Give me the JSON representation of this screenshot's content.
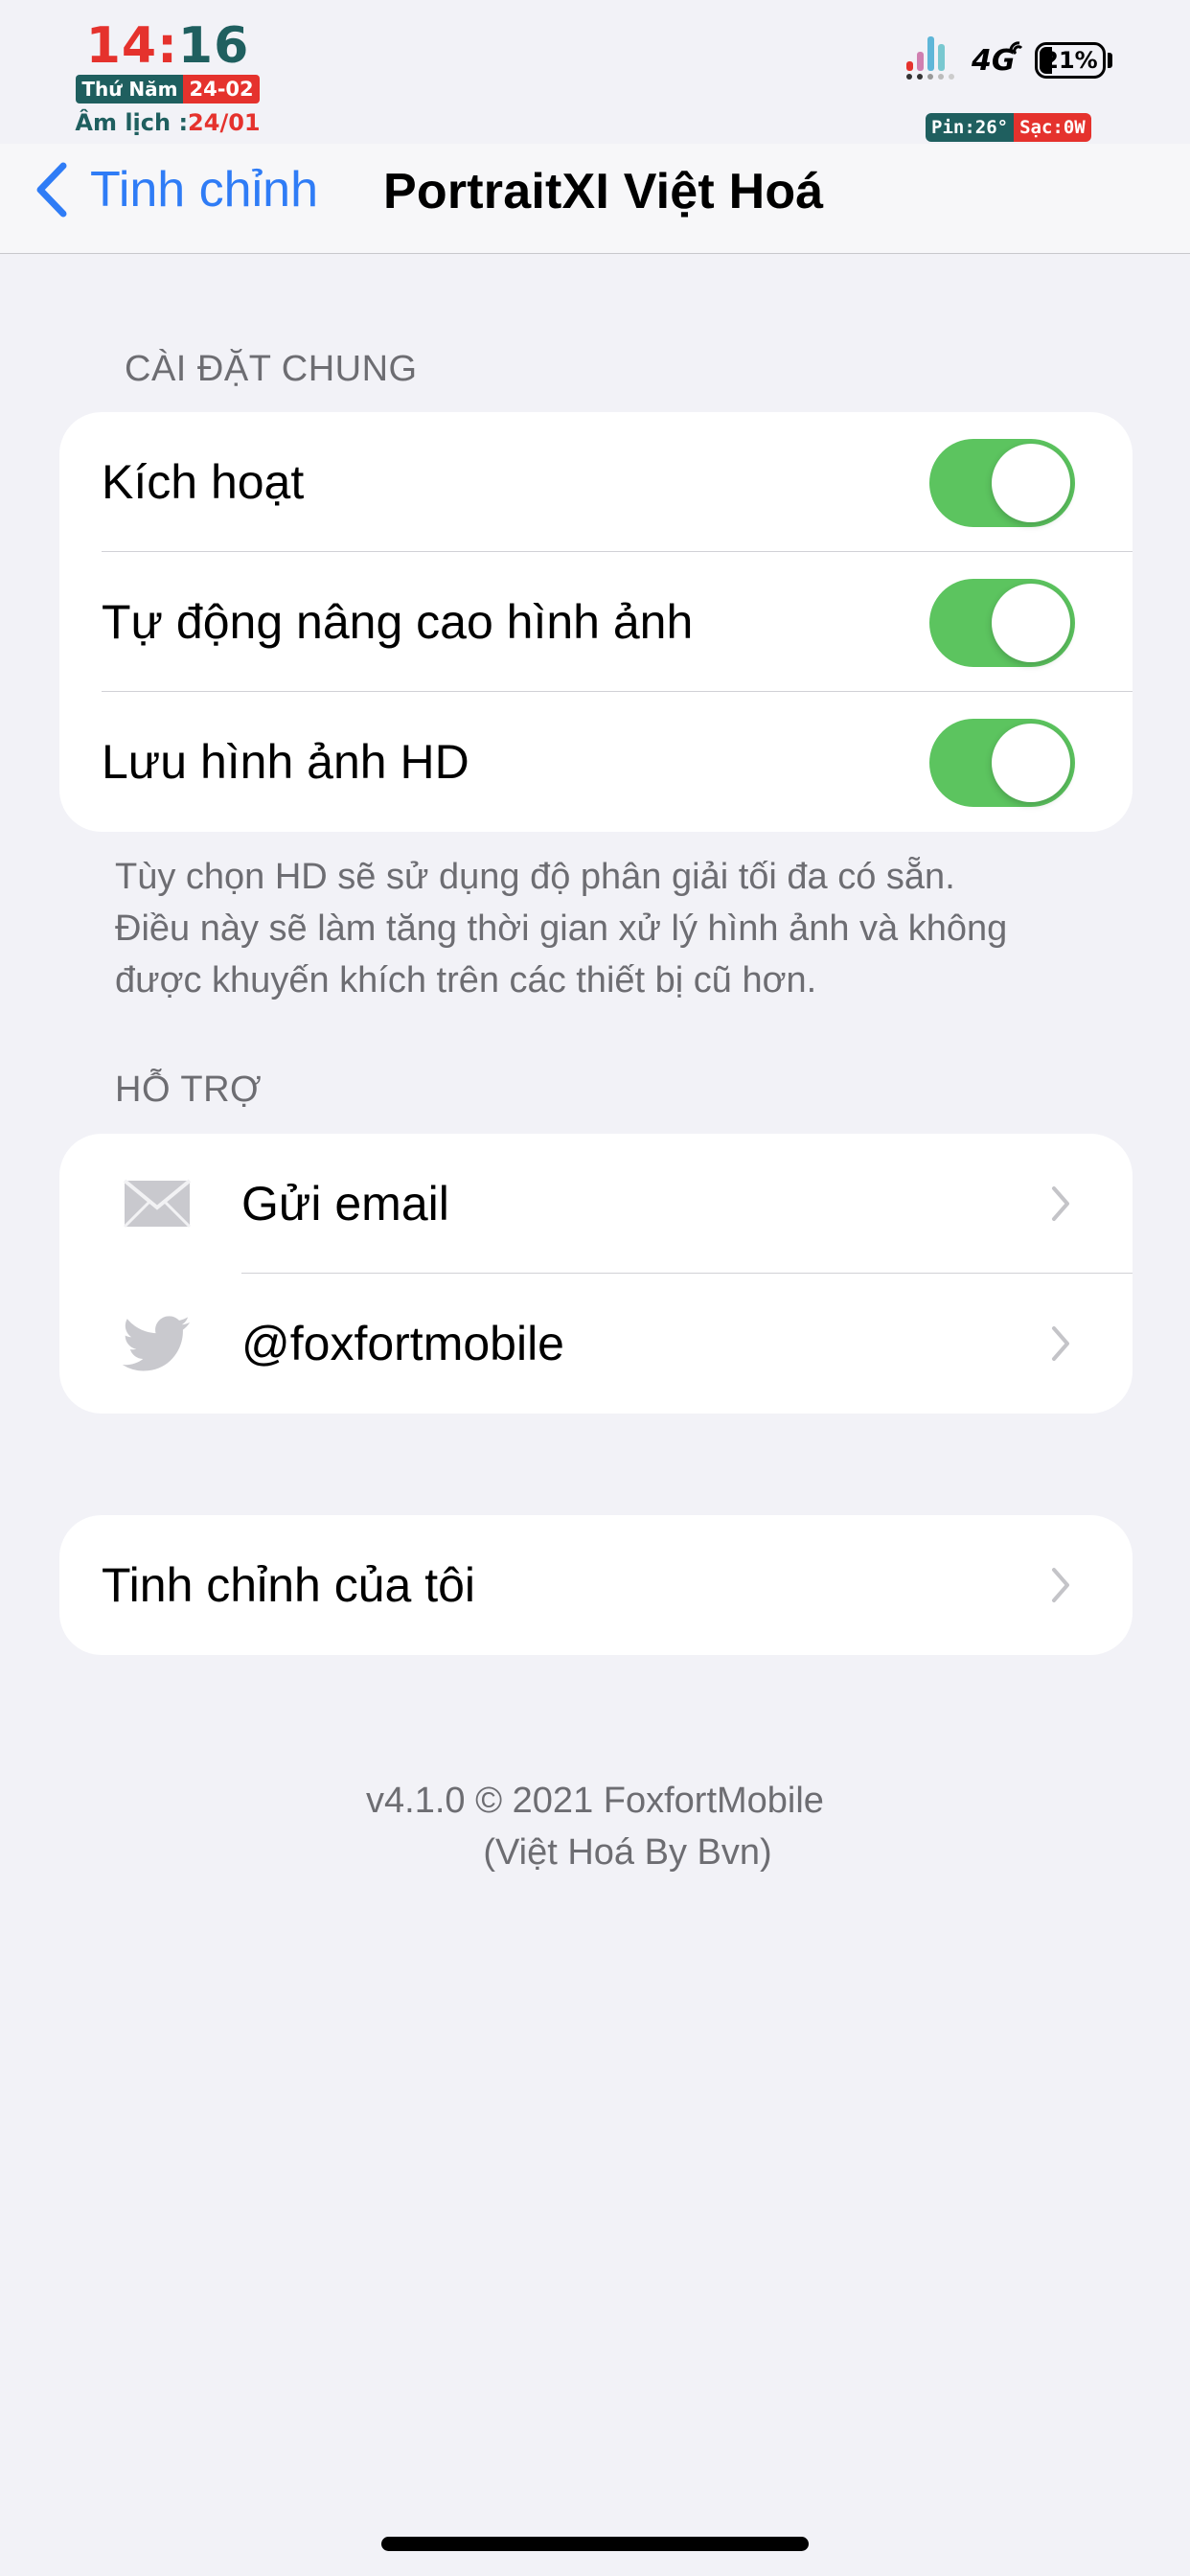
{
  "status_bar": {
    "clock_hour": "14",
    "clock_sep": ":",
    "clock_min": "16",
    "weekday": "Thứ Năm",
    "date": "24-02",
    "lunar_label": "Âm lịch :",
    "lunar_value": "24/01",
    "network": "4G",
    "battery": "21%",
    "battery_level": 0.21,
    "pin_temp": "Pin:26°",
    "pin_charge": "Sạc:0W"
  },
  "nav": {
    "back_label": "Tinh chỉnh",
    "title": "PortraitXI Việt Hoá"
  },
  "general": {
    "header": "CÀI ĐẶT CHUNG",
    "rows": [
      {
        "label": "Kích hoạt",
        "on": true
      },
      {
        "label": "Tự động nâng cao hình ảnh",
        "on": true
      },
      {
        "label": "Lưu hình ảnh HD",
        "on": true
      }
    ],
    "footer_lines": [
      "Tùy chọn HD sẽ sử dụng độ phân giải tối đa có sẵn.",
      "Điều này sẽ làm tăng thời gian xử lý hình ảnh và không",
      "được khuyến khích trên các thiết bị cũ hơn."
    ]
  },
  "support": {
    "header": "HỖ TRỢ",
    "rows": [
      {
        "label": "Gửi email",
        "icon": "mail-icon"
      },
      {
        "label": "@foxfortmobile",
        "icon": "twitter-icon"
      }
    ]
  },
  "my_tweaks": {
    "label": "Tinh chỉnh của tôi"
  },
  "version": {
    "line1": "v4.1.0 © 2021 FoxfortMobile",
    "line2": "(Việt Hoá By Bvn)"
  },
  "colors": {
    "accent": "#2f7cf6",
    "toggle_on": "#5cc45f",
    "background": "#f2f2f7",
    "clock_red": "#e5322d",
    "clock_teal": "#1f5f5f"
  }
}
